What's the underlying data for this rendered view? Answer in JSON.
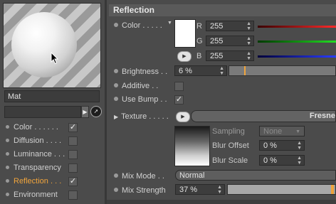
{
  "preview": {
    "sphere": "material-sphere",
    "cursor": "arrow-cursor-icon"
  },
  "material": {
    "name": "Mat",
    "sub_value": ""
  },
  "channels": [
    {
      "label": "Color . . . . . .",
      "checked": true,
      "active": false
    },
    {
      "label": "Diffusion . . . .",
      "checked": false,
      "active": false
    },
    {
      "label": "Luminance . . .",
      "checked": false,
      "active": false
    },
    {
      "label": "Transparency",
      "checked": false,
      "active": false
    },
    {
      "label": "Reflection . . .",
      "checked": true,
      "active": true
    },
    {
      "label": "Environment",
      "checked": false,
      "active": false
    }
  ],
  "panel": {
    "title": "Reflection",
    "color": {
      "label": "Color . . . . .",
      "swatch": "#ffffff",
      "r_label": "R",
      "r_value": "255",
      "g_label": "G",
      "g_value": "255",
      "b_label": "B",
      "b_value": "255",
      "r_color": "#ff2a2a",
      "g_color": "#22dd22",
      "b_color": "#2a3cff"
    },
    "brightness": {
      "label": "Brightness . .",
      "value": "6 %",
      "fraction": 0.06
    },
    "additive": {
      "label": "Additive . .",
      "checked": false
    },
    "use_bump": {
      "label": "Use Bump . .",
      "checked": true
    },
    "texture": {
      "label": "Texture . . . . .",
      "name": "Fresne"
    },
    "sampling": {
      "label": "Sampling",
      "value": "None"
    },
    "blur_offset": {
      "label": "Blur Offset",
      "value": "0 %"
    },
    "blur_scale": {
      "label": "Blur Scale",
      "value": "0 %"
    },
    "mix_mode": {
      "label": "Mix Mode . .",
      "value": "Normal"
    },
    "mix_strength": {
      "label": "Mix Strength",
      "value": "37 %",
      "fraction": 0.37
    }
  },
  "accent": "#f0a43c"
}
